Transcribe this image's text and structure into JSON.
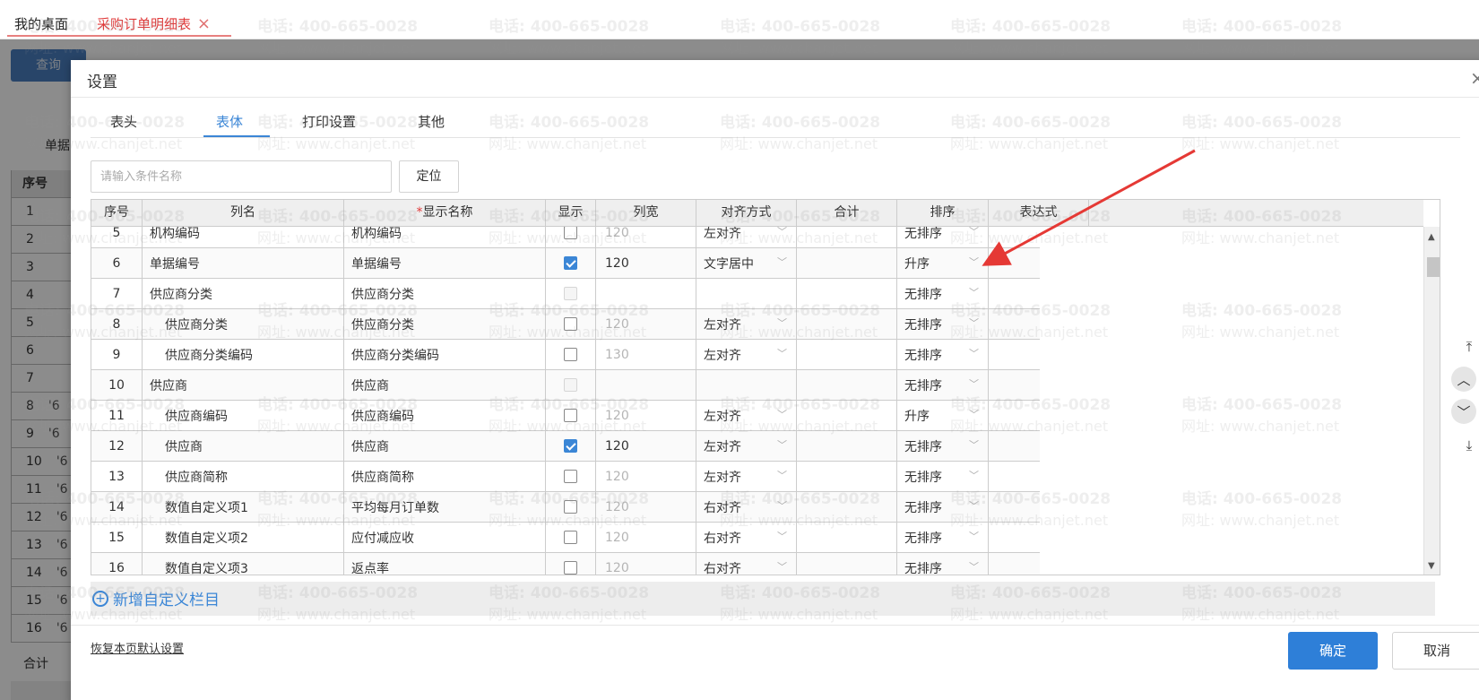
{
  "app_tabs": [
    {
      "label": "我的桌面"
    },
    {
      "label": "采购订单明细表"
    }
  ],
  "background": {
    "query_button": "查询",
    "filter_label": "单据",
    "table_header": "序号",
    "row_numbers": [
      "1",
      "2",
      "3",
      "4",
      "5",
      "6",
      "7",
      "8",
      "9",
      "10",
      "11",
      "12",
      "13",
      "14",
      "15",
      "16"
    ],
    "row_partial_values": [
      "",
      "",
      "",
      "",
      "",
      "",
      "",
      "'6",
      "'6",
      "'6",
      "'6",
      "'6",
      "'6",
      "'6",
      "'6",
      "'6"
    ],
    "total_label": "合计"
  },
  "dialog": {
    "title": "设置",
    "close_icon": "×",
    "tabs": [
      {
        "label": "表头",
        "active": false
      },
      {
        "label": "表体",
        "active": true
      },
      {
        "label": "打印设置",
        "active": false
      },
      {
        "label": "其他",
        "active": false
      }
    ],
    "search": {
      "placeholder": "请输入条件名称",
      "value": ""
    },
    "locate_button": "定位",
    "columns": [
      {
        "key": "seq",
        "label": "序号"
      },
      {
        "key": "col_name",
        "label": "列名"
      },
      {
        "key": "display_name",
        "label": "显示名称",
        "required": true
      },
      {
        "key": "show",
        "label": "显示"
      },
      {
        "key": "width",
        "label": "列宽"
      },
      {
        "key": "align",
        "label": "对齐方式"
      },
      {
        "key": "sum",
        "label": "合计"
      },
      {
        "key": "sort",
        "label": "排序"
      },
      {
        "key": "expr",
        "label": "表达式"
      }
    ],
    "rows": [
      {
        "seq": "5",
        "name": "机构编码",
        "indent": false,
        "display": "机构编码",
        "show": "unchecked",
        "width": "120",
        "width_active": false,
        "align": "左对齐",
        "sort": "无排序"
      },
      {
        "seq": "6",
        "name": "单据编号",
        "indent": false,
        "display": "单据编号",
        "show": "checked",
        "width": "120",
        "width_active": true,
        "align": "文字居中",
        "sort": "升序"
      },
      {
        "seq": "7",
        "name": "供应商分类",
        "indent": false,
        "display": "供应商分类",
        "show": "disabled",
        "width": "",
        "width_active": false,
        "align": "",
        "sort": "无排序"
      },
      {
        "seq": "8",
        "name": "供应商分类",
        "indent": true,
        "display": "供应商分类",
        "show": "unchecked",
        "width": "120",
        "width_active": false,
        "align": "左对齐",
        "sort": "无排序"
      },
      {
        "seq": "9",
        "name": "供应商分类编码",
        "indent": true,
        "display": "供应商分类编码",
        "show": "unchecked",
        "width": "130",
        "width_active": false,
        "align": "左对齐",
        "sort": "无排序"
      },
      {
        "seq": "10",
        "name": "供应商",
        "indent": false,
        "display": "供应商",
        "show": "disabled",
        "width": "",
        "width_active": false,
        "align": "",
        "sort": "无排序"
      },
      {
        "seq": "11",
        "name": "供应商编码",
        "indent": true,
        "display": "供应商编码",
        "show": "unchecked",
        "width": "120",
        "width_active": false,
        "align": "左对齐",
        "sort": "升序"
      },
      {
        "seq": "12",
        "name": "供应商",
        "indent": true,
        "display": "供应商",
        "show": "checked",
        "width": "120",
        "width_active": true,
        "align": "左对齐",
        "sort": "无排序"
      },
      {
        "seq": "13",
        "name": "供应商简称",
        "indent": true,
        "display": "供应商简称",
        "show": "unchecked",
        "width": "120",
        "width_active": false,
        "align": "左对齐",
        "sort": "无排序"
      },
      {
        "seq": "14",
        "name": "数值自定义项1",
        "indent": true,
        "display": "平均每月订单数",
        "show": "unchecked",
        "width": "120",
        "width_active": false,
        "align": "右对齐",
        "sort": "无排序"
      },
      {
        "seq": "15",
        "name": "数值自定义项2",
        "indent": true,
        "display": "应付减应收",
        "show": "unchecked",
        "width": "120",
        "width_active": false,
        "align": "右对齐",
        "sort": "无排序"
      },
      {
        "seq": "16",
        "name": "数值自定义项3",
        "indent": true,
        "display": "返点率",
        "show": "unchecked",
        "width": "120",
        "width_active": false,
        "align": "右对齐",
        "sort": "无排序"
      }
    ],
    "add_custom_link": "新增自定义栏目",
    "reset_link": "恢复本页默认设置",
    "ok_button": "确定",
    "cancel_button": "取消"
  },
  "watermark": {
    "line1": "电话: 400-665-0028",
    "line2": "网址: www.chanjet.net"
  },
  "annotation": {
    "arrow_color": "#e53935"
  },
  "colors": {
    "accent": "#3b86d6",
    "primary_button": "#2e7fd8",
    "tab_active_red": "#e03a3a"
  }
}
